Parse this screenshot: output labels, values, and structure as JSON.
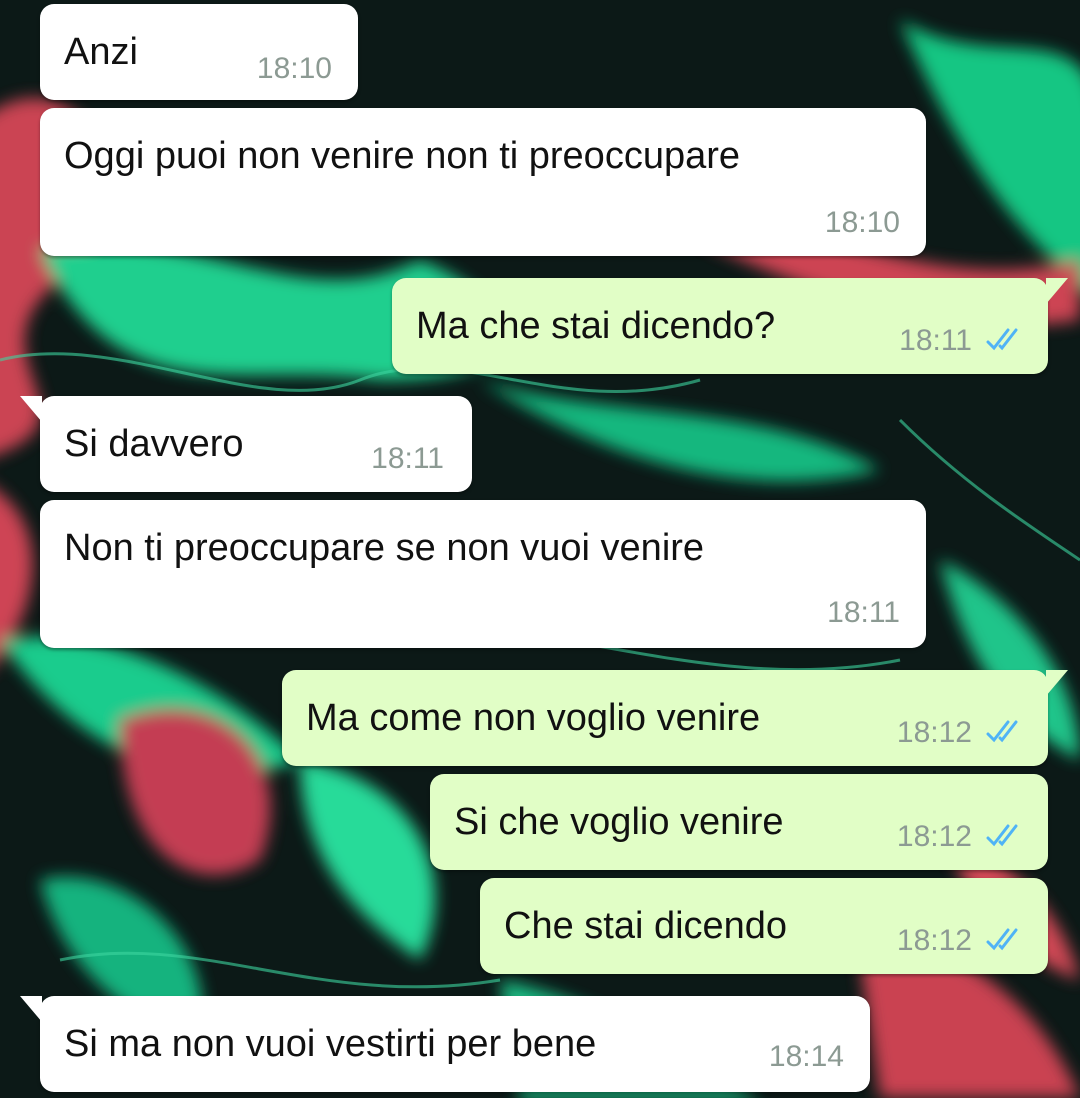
{
  "theme": {
    "incoming_bubble": "#ffffff",
    "outgoing_bubble": "#e1fec6",
    "read_tick_color": "#4fb3f6",
    "time_color": "#8c9a93"
  },
  "messages": [
    {
      "text": "Anzi",
      "time": "18:10",
      "direction": "incoming"
    },
    {
      "text": "Oggi puoi non venire non ti preoccupare",
      "time": "18:10",
      "direction": "incoming"
    },
    {
      "text": "Ma che stai dicendo?",
      "time": "18:11",
      "direction": "outgoing",
      "status_icon": "double-check-icon"
    },
    {
      "text": "Si davvero",
      "time": "18:11",
      "direction": "incoming"
    },
    {
      "text": "Non ti preoccupare se non vuoi venire",
      "time": "18:11",
      "direction": "incoming"
    },
    {
      "text": "Ma come non voglio venire",
      "time": "18:12",
      "direction": "outgoing",
      "status_icon": "double-check-icon"
    },
    {
      "text": "Si che voglio venire",
      "time": "18:12",
      "direction": "outgoing",
      "status_icon": "double-check-icon"
    },
    {
      "text": "Che stai dicendo",
      "time": "18:12",
      "direction": "outgoing",
      "status_icon": "double-check-icon"
    },
    {
      "text": "Si ma non vuoi vestirti per bene",
      "time": "18:14",
      "direction": "incoming"
    }
  ]
}
